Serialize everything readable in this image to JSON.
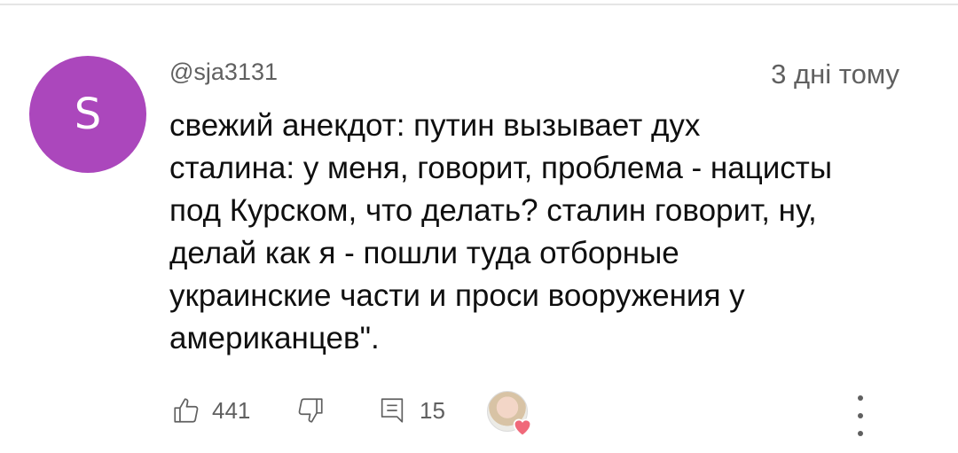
{
  "comment": {
    "avatar_letter": "S",
    "avatar_color": "#ab47bc",
    "handle": "@sja3131",
    "time": "3 дні тому",
    "text": "свежий анекдот: путин вызывает дух\nсталина: у меня, говорит, проблема - нацисты\nпод Курском, что делать? сталин говорит, ну,\nделай как я - пошли туда отборные\nукраинские части и проси вооружения у\nамериканцев\"."
  },
  "actions": {
    "likes": "441",
    "replies": "15"
  },
  "icons": {
    "like": "thumb-up-icon",
    "dislike": "thumb-down-icon",
    "reply": "reply-icon",
    "heart": "heart-icon",
    "more": "more-vertical-icon"
  },
  "colors": {
    "heart": "#f0697a",
    "secondary_text": "#606060"
  }
}
